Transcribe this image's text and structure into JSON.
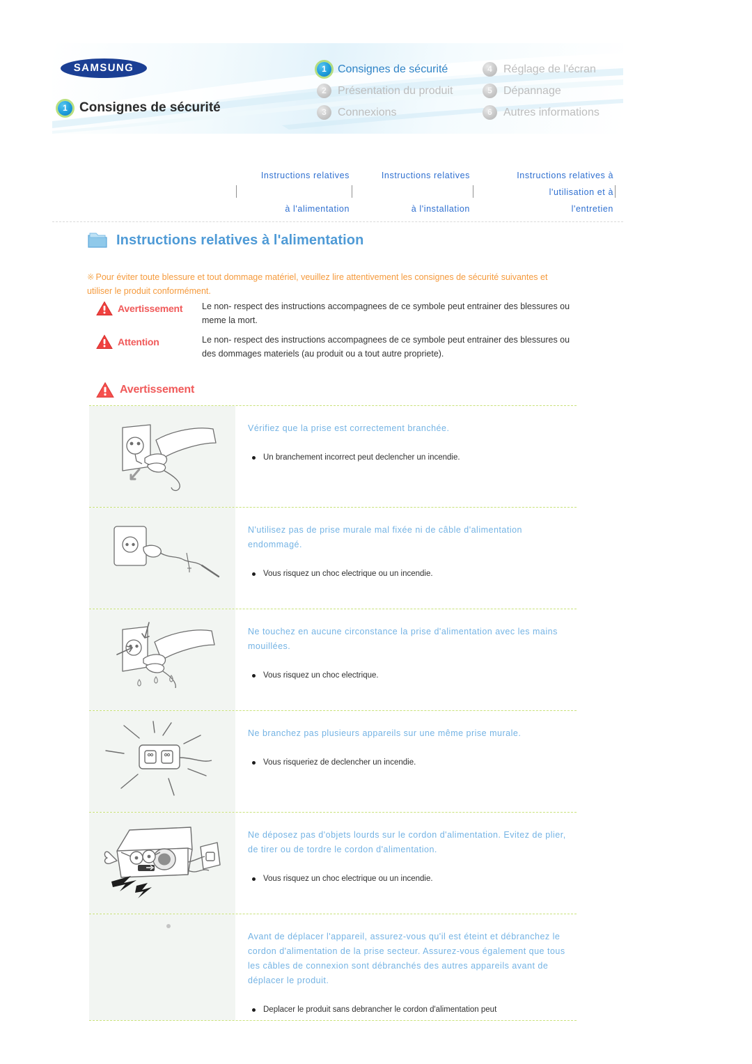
{
  "header": {
    "brand": "SAMSUNG",
    "page_title": "Consignes de sécurité",
    "page_title_number": "1",
    "nav_items": [
      {
        "number": "1",
        "label": "Consignes de sécurité",
        "active": true
      },
      {
        "number": "4",
        "label": "Réglage de l'écran",
        "active": false
      },
      {
        "number": "2",
        "label": "Présentation du produit",
        "active": false
      },
      {
        "number": "5",
        "label": "Dépannage",
        "active": false
      },
      {
        "number": "3",
        "label": "Connexions",
        "active": false
      },
      {
        "number": "6",
        "label": "Autres informations",
        "active": false
      }
    ]
  },
  "tabs": [
    {
      "line1": "Instructions relatives",
      "line2": "à l'alimentation"
    },
    {
      "line1": "Instructions relatives",
      "line2": "à l'installation"
    },
    {
      "line1": "Instructions relatives à",
      "line2": "l'utilisation et à",
      "line3": "l'entretien"
    }
  ],
  "section": {
    "banner_title": "Instructions relatives à l'alimentation",
    "intro_mark": "※",
    "intro_text": "Pour éviter toute blessure et tout dommage matériel, veuillez lire attentivement les consignes de sécurité suivantes et utiliser le produit conformément."
  },
  "legend": [
    {
      "label": "Avertissement",
      "description": "Le non- respect des instructions accompagnees de ce symbole peut entrainer des blessures ou meme la mort."
    },
    {
      "label": "Attention",
      "description": "Le non- respect des instructions accompagnees de ce symbole peut entrainer des blessures ou des dommages materiels (au produit ou a tout autre propriete)."
    }
  ],
  "warning_heading": "Avertissement",
  "safety_items": [
    {
      "icon": "hand-plugging-cord-into-wall-socket-illustration",
      "heading": "Vérifiez que la prise est correctement branchée.",
      "bullets": [
        "Un branchement incorrect peut declencher un incendie."
      ]
    },
    {
      "icon": "damaged-power-cable-wall-socket-illustration",
      "heading": "N'utilisez pas de prise murale mal fixée ni de câble d'alimentation endommagé.",
      "bullets": [
        "Vous risquez un choc electrique ou un incendie."
      ]
    },
    {
      "icon": "wet-hand-touching-power-plug-illustration",
      "heading": "Ne touchez en aucune circonstance la prise d'alimentation avec les mains mouillées.",
      "bullets": [
        "Vous risquez un choc electrique."
      ]
    },
    {
      "icon": "overloaded-multi-plug-socket-illustration",
      "heading": "Ne branchez pas plusieurs appareils sur une même prise murale.",
      "bullets": [
        "Vous risqueriez de declencher un incendie."
      ]
    },
    {
      "icon": "projector-with-bent-power-cord-illustration",
      "heading": "Ne déposez pas d'objets lourds sur le cordon d'alimentation. Evitez de plier, de tirer ou de tordre le cordon d'alimentation.",
      "bullets": [
        "Vous risquez un choc electrique ou un incendie."
      ]
    },
    {
      "icon": "moving-product-unplug-illustration",
      "heading": "Avant de déplacer l'appareil, assurez-vous qu'il est éteint et débranchez le cordon d'alimentation de la prise secteur. Assurez-vous également que tous les câbles de connexion sont débranchés des autres appareils avant de déplacer le produit.",
      "bullets": [
        "Deplacer le produit sans debrancher le cordon d'alimentation peut"
      ]
    }
  ],
  "colors": {
    "accent_blue": "#2e83c6",
    "tab_blue": "#2e6fd0",
    "heading_blue": "#74b3e4",
    "banner_blue": "#4e9ad6",
    "warning_red": "#f05a5a",
    "intro_orange": "#f59a3c",
    "divider_green": "#c9e27a",
    "brand_navy": "#1b3f94"
  }
}
